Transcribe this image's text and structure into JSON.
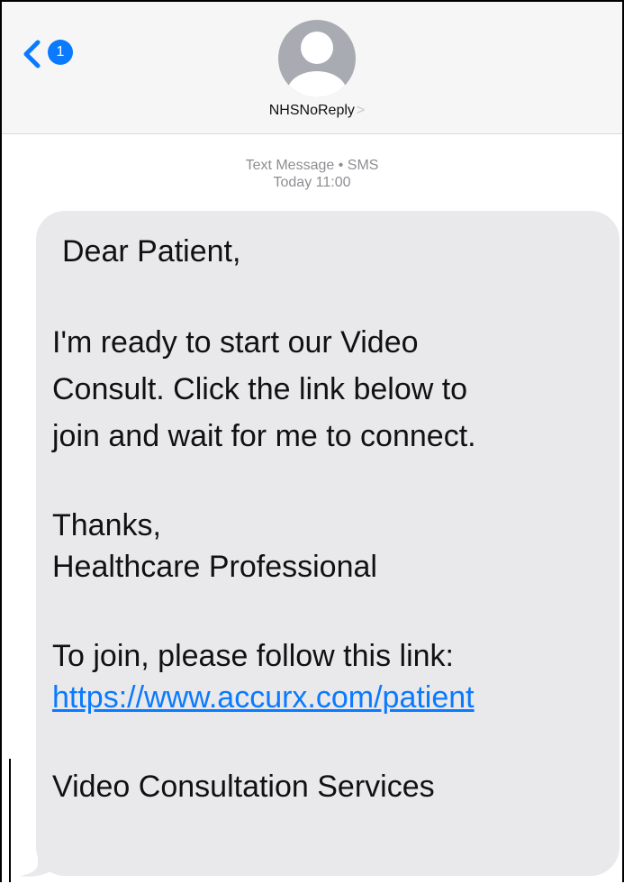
{
  "header": {
    "back_badge_count": "1",
    "contact_name": "NHSNoReply",
    "contact_chevron": ">"
  },
  "meta": {
    "type_label": "Text Message • SMS",
    "time_label": "Today 11:00"
  },
  "message": {
    "greeting": "Dear Patient,",
    "body_line1": "I'm ready to start our Video",
    "body_line2": "Consult. Click the link below to",
    "body_line3": "join and wait for me to connect.",
    "thanks": "Thanks,",
    "signature": "Healthcare Professional",
    "join_text": "To join, please follow this link:",
    "link": "https://www.accurx.com/patient",
    "service": "Video Consultation Services"
  },
  "colors": {
    "accent": "#0a7aff",
    "bubble": "#e9e9eb",
    "header_bg": "#f6f6f7",
    "avatar": "#a9abb3",
    "meta_text": "#8e8e93"
  }
}
